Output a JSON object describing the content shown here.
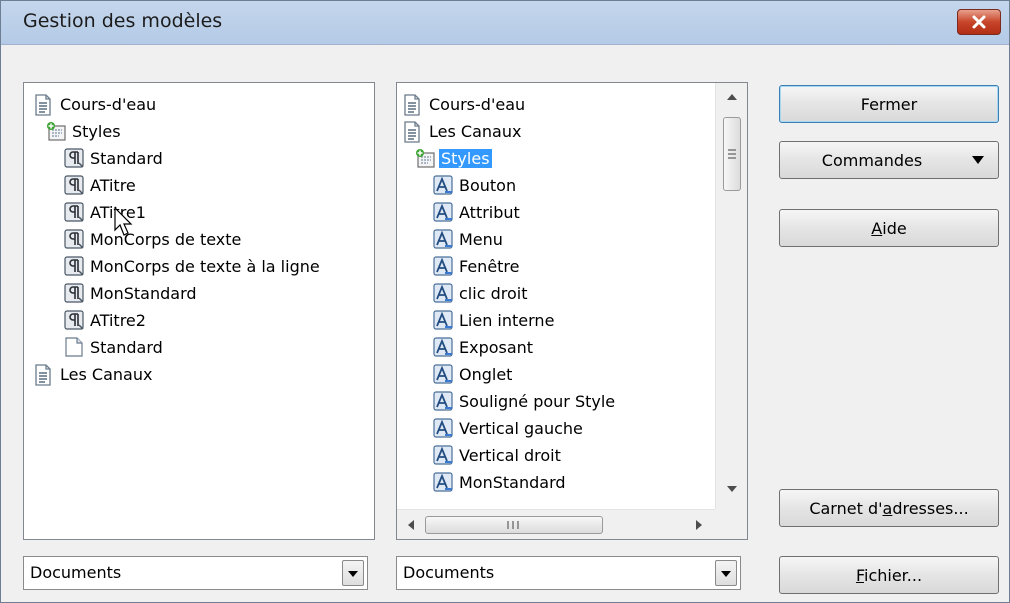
{
  "window": {
    "title": "Gestion des modèles"
  },
  "left_tree": {
    "items": [
      {
        "label": "Cours-d'eau"
      },
      {
        "label": "Styles"
      },
      {
        "label": "Standard"
      },
      {
        "label": "ATitre"
      },
      {
        "label": "ATitre1"
      },
      {
        "label": "MonCorps de texte"
      },
      {
        "label": "MonCorps de texte à la ligne"
      },
      {
        "label": "MonStandard"
      },
      {
        "label": "ATitre2"
      },
      {
        "label": "Standard"
      },
      {
        "label": "Les Canaux"
      }
    ]
  },
  "right_tree": {
    "items": [
      {
        "label": "Cours-d'eau"
      },
      {
        "label": "Les Canaux"
      },
      {
        "label": "Styles"
      },
      {
        "label": "Bouton"
      },
      {
        "label": "Attribut"
      },
      {
        "label": "Menu"
      },
      {
        "label": "Fenêtre"
      },
      {
        "label": "clic droit"
      },
      {
        "label": "Lien interne"
      },
      {
        "label": "Exposant"
      },
      {
        "label": "Onglet"
      },
      {
        "label": "Souligné pour Style"
      },
      {
        "label": "Vertical gauche"
      },
      {
        "label": "Vertical droit"
      },
      {
        "label": "MonStandard"
      }
    ],
    "selected": "Styles"
  },
  "left_combo": {
    "value": "Documents"
  },
  "right_combo": {
    "value": "Documents"
  },
  "buttons": {
    "close": "Fermer",
    "commands": "Commandes",
    "help_mnemonic": "A",
    "help_rest": "ide",
    "address_pre": "Carnet d'",
    "address_mnemonic": "a",
    "address_post": "dresses...",
    "file_mnemonic": "F",
    "file_rest": "ichier..."
  },
  "icons": {
    "document": "document-icon",
    "styles_folder": "styles-folder-icon",
    "paragraph_style": "paragraph-style-icon",
    "character_style": "character-style-icon",
    "page_style": "page-style-icon"
  }
}
